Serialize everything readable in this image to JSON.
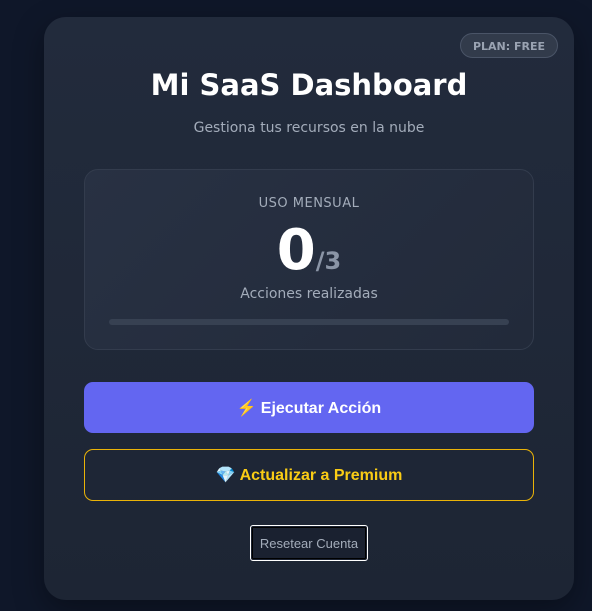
{
  "app": {
    "plan_badge": "PLAN: FREE",
    "title": "Mi SaaS Dashboard",
    "subtitle": "Gestiona tus recursos en la nube"
  },
  "usage": {
    "label": "USO MENSUAL",
    "current": "0",
    "limit": "/3",
    "caption": "Acciones realizadas",
    "progress_fraction": 0
  },
  "actions": {
    "execute_icon": "lightning-icon",
    "execute_glyph": "⚡",
    "execute_label": "Ejecutar Acción",
    "premium_icon": "gem-icon",
    "premium_glyph": "💎",
    "premium_label": "Actualizar a Premium",
    "reset_label": "Resetear Cuenta"
  },
  "colors": {
    "accent": "#6366f1",
    "premium": "#facc15",
    "background": "#0f1729",
    "card": "#1f2737"
  }
}
